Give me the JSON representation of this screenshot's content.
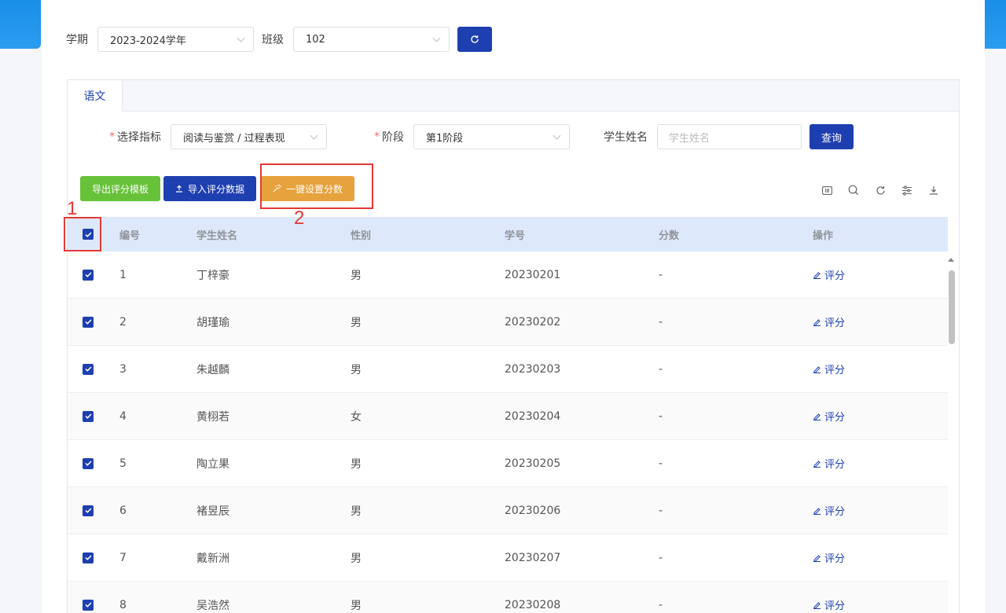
{
  "topbar": {
    "term_label": "学期",
    "term_value": "2023-2024学年",
    "class_label": "班级",
    "class_value": "102"
  },
  "tab": {
    "label": "语文"
  },
  "filters": {
    "indicator_label": "选择指标",
    "indicator_value": "阅读与鉴赏 / 过程表现",
    "stage_label": "阶段",
    "stage_value": "第1阶段",
    "name_label": "学生姓名",
    "name_placeholder": "学生姓名",
    "query_label": "查询",
    "required_mark": "*"
  },
  "actions": {
    "export_label": "导出评分模板",
    "import_label": "导入评分数据",
    "set_score_label": "一键设置分数"
  },
  "tools": [
    "columns-icon",
    "search-icon",
    "refresh-icon",
    "filter-icon",
    "download-icon"
  ],
  "table": {
    "headers": [
      "编号",
      "学生姓名",
      "性别",
      "学号",
      "分数",
      "操作"
    ],
    "rows": [
      [
        "1",
        "丁梓豪",
        "男",
        "20230201",
        "-"
      ],
      [
        "2",
        "胡瑾瑜",
        "男",
        "20230202",
        "-"
      ],
      [
        "3",
        "朱越麟",
        "男",
        "20230203",
        "-"
      ],
      [
        "4",
        "黄栩若",
        "女",
        "20230204",
        "-"
      ],
      [
        "5",
        "陶立果",
        "男",
        "20230205",
        "-"
      ],
      [
        "6",
        "褚昱辰",
        "男",
        "20230206",
        "-"
      ],
      [
        "7",
        "戴新洲",
        "男",
        "20230207",
        "-"
      ],
      [
        "8",
        "吴浩然",
        "男",
        "20230208",
        "-"
      ]
    ],
    "action_label": "评分"
  },
  "annotations": [
    "1",
    "2"
  ],
  "colors": {
    "primary": "#1e3fb0",
    "success": "#67c23a",
    "warning": "#e6a23c",
    "annotation": "#e53935"
  }
}
